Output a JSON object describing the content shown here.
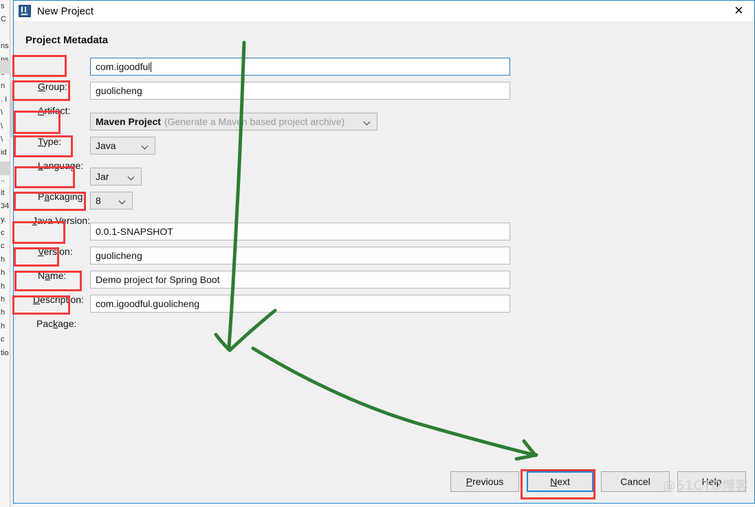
{
  "window": {
    "title": "New Project",
    "icon": "intellij-idea-icon",
    "close_label": "✕"
  },
  "section": {
    "title": "Project Metadata"
  },
  "form": {
    "rows": [
      {
        "key": "group",
        "label_pre": "",
        "label_mn": "G",
        "label_post": "roup:",
        "type": "text",
        "value": "com.igoodful",
        "focused": true,
        "caret": true
      },
      {
        "key": "artifact",
        "label_pre": "",
        "label_mn": "A",
        "label_post": "rtifact:",
        "type": "text",
        "value": "guolicheng",
        "focused": false,
        "caret": false
      },
      {
        "key": "type",
        "label_pre": "",
        "label_mn": "T",
        "label_post": "ype:",
        "type": "combo",
        "value": "Maven Project",
        "hint": "(Generate a Maven based project archive)"
      },
      {
        "key": "language",
        "label_pre": "",
        "label_mn": "L",
        "label_post": "anguage:",
        "type": "combo",
        "value": "Java",
        "hint": ""
      },
      {
        "key": "packaging",
        "label_pre": "P",
        "label_mn": "a",
        "label_post": "ckaging:",
        "type": "combo",
        "value": "Jar",
        "hint": ""
      },
      {
        "key": "javaversion",
        "label_pre": "",
        "label_mn": "J",
        "label_post": "ava Version:",
        "type": "combo",
        "value": "8",
        "hint": ""
      },
      {
        "key": "version",
        "label_pre": "",
        "label_mn": "V",
        "label_post": "ersion:",
        "type": "text",
        "value": "0.0.1-SNAPSHOT",
        "focused": false,
        "caret": false
      },
      {
        "key": "name",
        "label_pre": "N",
        "label_mn": "a",
        "label_post": "me:",
        "type": "text",
        "value": "guolicheng",
        "focused": false,
        "caret": false
      },
      {
        "key": "description",
        "label_pre": "",
        "label_mn": "D",
        "label_post": "escription:",
        "type": "text",
        "value": "Demo project for Spring Boot",
        "focused": false,
        "caret": false
      },
      {
        "key": "package",
        "label_pre": "Pac",
        "label_mn": "k",
        "label_post": "age:",
        "type": "text",
        "value": "com.igoodful.guolicheng",
        "focused": false,
        "caret": false
      }
    ]
  },
  "buttons": [
    {
      "key": "previous",
      "pre": "",
      "mn": "P",
      "post": "revious",
      "focused": false,
      "annotated": false
    },
    {
      "key": "next",
      "pre": "",
      "mn": "N",
      "post": "ext",
      "focused": true,
      "annotated": true
    },
    {
      "key": "cancel",
      "pre": "Cancel",
      "mn": "",
      "post": "",
      "focused": false,
      "annotated": false
    },
    {
      "key": "help",
      "pre": "Help",
      "mn": "",
      "post": "",
      "focused": false,
      "annotated": false
    }
  ],
  "annotations": {
    "red_color": "#f43b3b",
    "green_color": "#2e7d32",
    "focus_blue": "#1e88d4",
    "label_boxes": [
      "group",
      "artifact",
      "type",
      "language",
      "packaging",
      "javaversion",
      "version",
      "name",
      "description",
      "package"
    ],
    "green_marks": [
      "down-arrow-to-fields",
      "curved-arrow-to-next-button"
    ]
  },
  "watermark": {
    "text": "@51CTO博客"
  },
  "background_window": {
    "text_sliver": "s\nC\n\nns\nns\no\nn\n. I\n\\\n\\\n\\\nid\nke\n..\nit\n34\ny.\nc\nc\nh\nh\nh\nh\nh\nh\nc\ntio"
  }
}
